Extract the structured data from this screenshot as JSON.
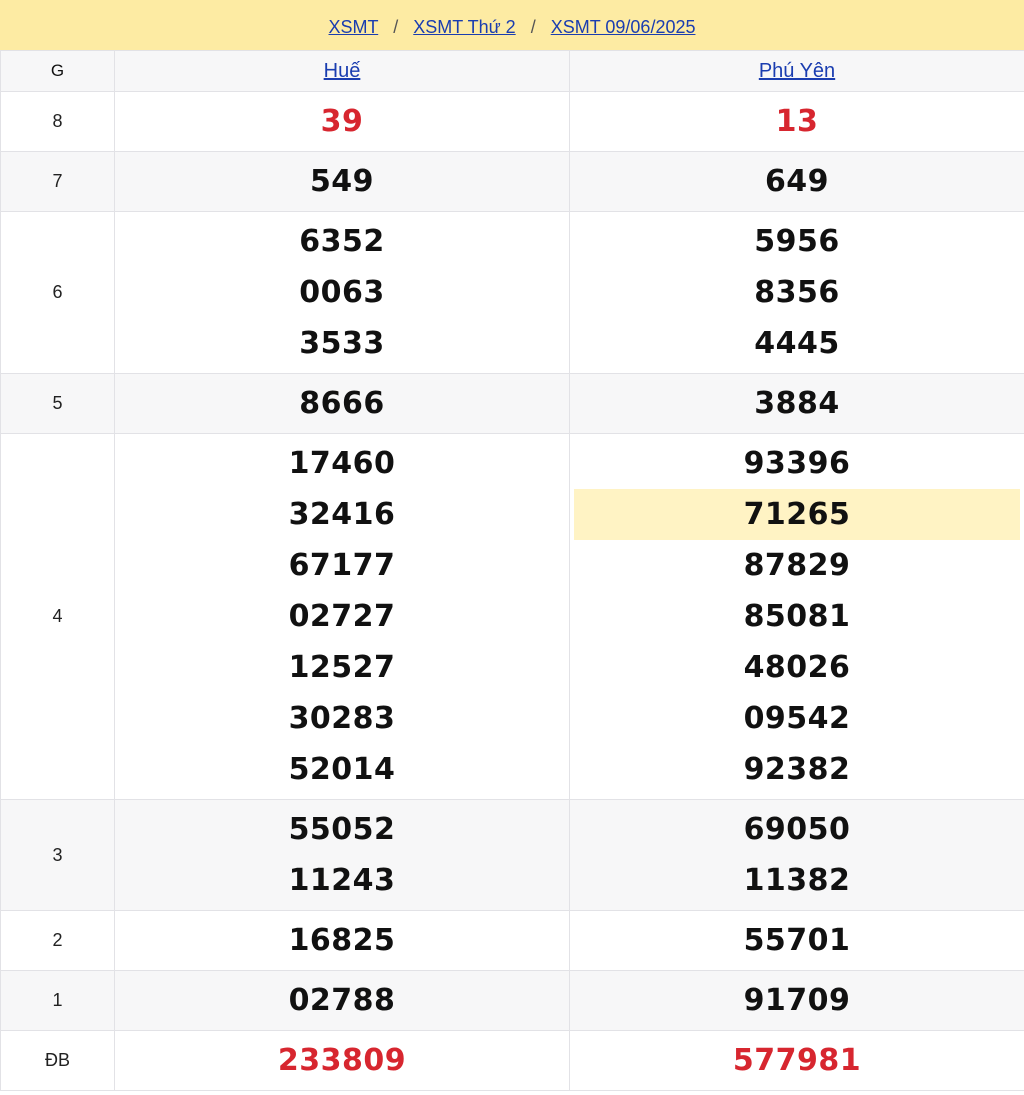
{
  "breadcrumb": [
    "XSMT",
    "XSMT Thứ 2",
    "XSMT 09/06/2025"
  ],
  "table": {
    "col_label": "G",
    "provinces": [
      "Huế",
      "Phú Yên"
    ],
    "rows": [
      {
        "label": "8",
        "red": true,
        "hue": [
          "39"
        ],
        "phu_yen": [
          "13"
        ]
      },
      {
        "label": "7",
        "hue": [
          "549"
        ],
        "phu_yen": [
          "649"
        ]
      },
      {
        "label": "6",
        "hue": [
          "6352",
          "0063",
          "3533"
        ],
        "phu_yen": [
          "5956",
          "8356",
          "4445"
        ]
      },
      {
        "label": "5",
        "hue": [
          "8666"
        ],
        "phu_yen": [
          "3884"
        ]
      },
      {
        "label": "4",
        "hue": [
          "17460",
          "32416",
          "67177",
          "02727",
          "12527",
          "30283",
          "52014"
        ],
        "phu_yen": [
          "93396",
          "71265",
          "87829",
          "85081",
          "48026",
          "09542",
          "92382"
        ],
        "highlight": {
          "phu_yen": 1
        }
      },
      {
        "label": "3",
        "hue": [
          "55052",
          "11243"
        ],
        "phu_yen": [
          "69050",
          "11382"
        ]
      },
      {
        "label": "2",
        "hue": [
          "16825"
        ],
        "phu_yen": [
          "55701"
        ]
      },
      {
        "label": "1",
        "hue": [
          "02788"
        ],
        "phu_yen": [
          "91709"
        ]
      },
      {
        "label": "ĐB",
        "red": true,
        "hue": [
          "233809"
        ],
        "phu_yen": [
          "577981"
        ]
      }
    ]
  },
  "colors": {
    "header_bg": "#fdeba3",
    "link": "#1a3db0",
    "red": "#d7262f",
    "highlight": "#fff3c4"
  }
}
